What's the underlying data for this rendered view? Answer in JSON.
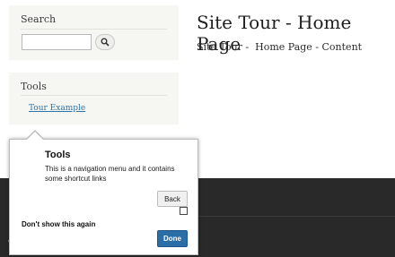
{
  "sidebar": {
    "search": {
      "title": "Search",
      "input_value": "",
      "button_icon": "search-icon"
    },
    "tools": {
      "title": "Tools",
      "link_label": "Tour Example"
    }
  },
  "main": {
    "title": "Site Tour - Home Page",
    "content": "Site Tour -  Home Page - Content"
  },
  "tour_popup": {
    "title": "Tools",
    "text": "This is a navigation menu and it contains some shortcut links",
    "back_label": "Back",
    "dont_show_label": "Don't show this again",
    "dont_show_checked": false,
    "done_label": "Done"
  },
  "colors": {
    "link": "#2d73a6",
    "done_button": "#2a6ea8",
    "footer": "#292929",
    "sidebar_block": "#f6f6f2"
  }
}
